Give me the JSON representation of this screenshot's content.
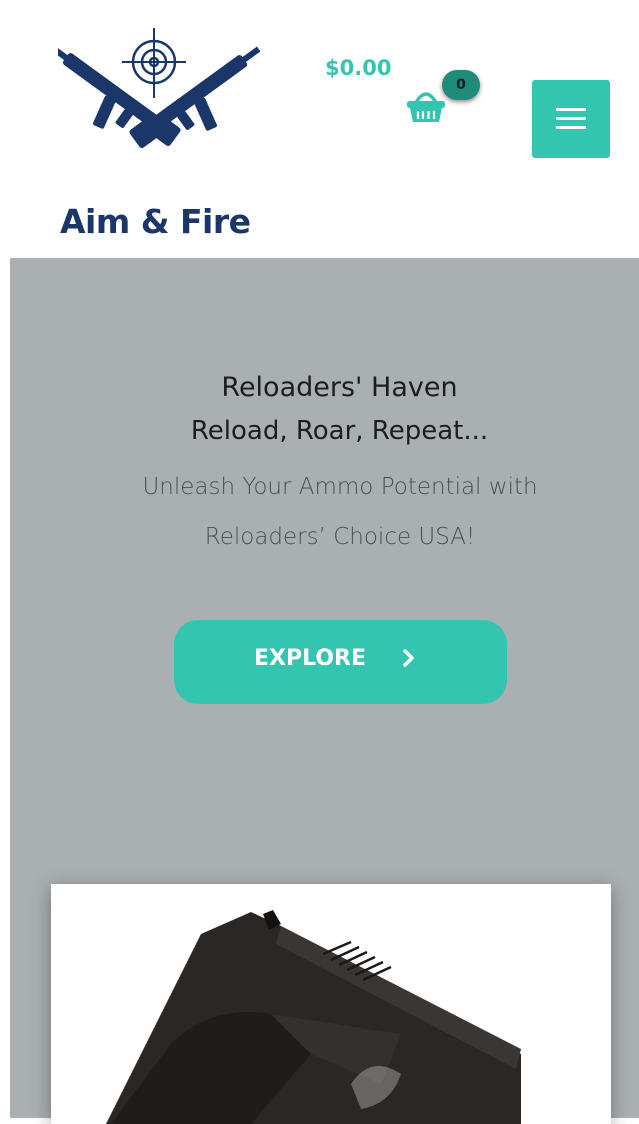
{
  "brand": {
    "name": "Aim & Fire",
    "color": "#1b3668"
  },
  "header": {
    "cart_total": "$0.00",
    "cart_count": "0",
    "menu_icon": "hamburger-icon",
    "cart_icon": "basket-icon"
  },
  "hero": {
    "title": "Reloaders' Haven",
    "subtitle": "Reload, Roar, Repeat...",
    "text": "Unleash Your Ammo Potential with Reloaders’ Choice USA!",
    "button_label": "EXPLORE",
    "button_icon": "chevron-right-icon"
  },
  "colors": {
    "accent": "#34c5b0",
    "badge": "#1e8b7b",
    "hero_background": "#aab0b1",
    "brand_navy": "#1b3668"
  }
}
